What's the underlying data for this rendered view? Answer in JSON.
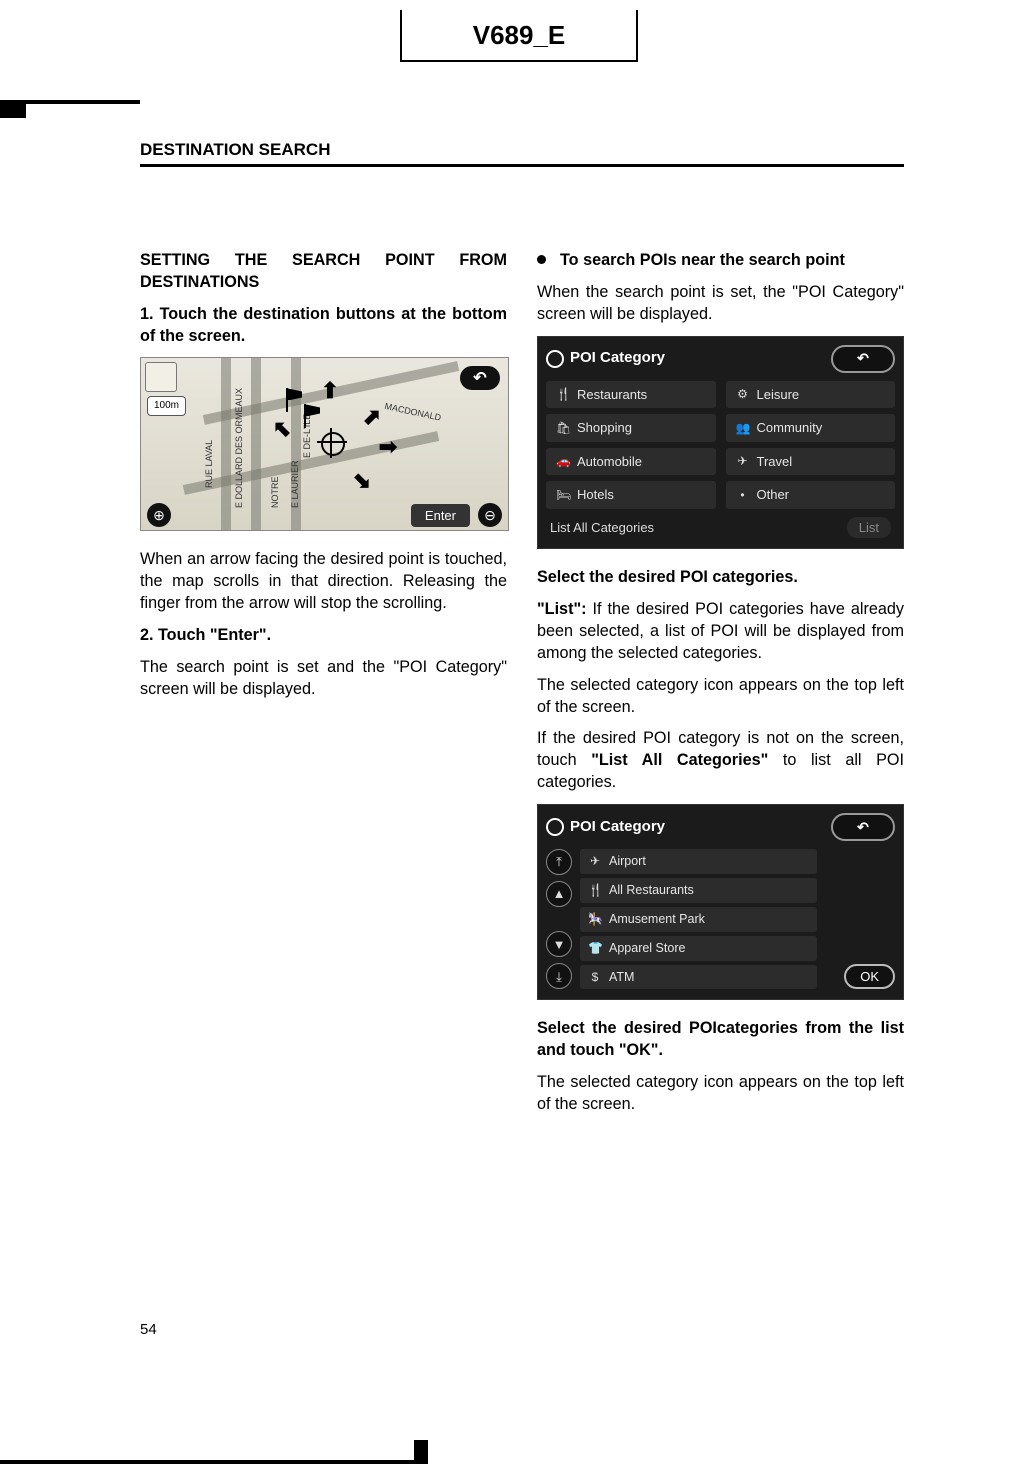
{
  "header": {
    "title": "V689_E"
  },
  "section": {
    "title": "DESTINATION SEARCH"
  },
  "left": {
    "heading": "SETTING THE SEARCH POINT FROM DESTINATIONS",
    "step1": "1.  Touch the destination buttons at the bottom of the screen.",
    "map": {
      "scale": "100m",
      "enter": "Enter",
      "back_symbol": "↶",
      "plus": "⊕",
      "minus": "⊖",
      "streets": {
        "rue_laval": "RUE LAVAL",
        "dollard": "E DOLLARD DES ORMEAUX",
        "notre": "NOTRE",
        "laurier": "E LAURIER",
        "delile": "E DE-L'ILE",
        "macdonald": "MACDONALD"
      }
    },
    "p1": "When an arrow facing the desired point is touched, the map scrolls in that direction. Releasing the finger from the arrow will stop the scrolling.",
    "step2": "2.  Touch \"Enter\".",
    "p2": "The search point is set and the \"POI Category\" screen will be displayed."
  },
  "right": {
    "bullet": "To search POIs near the search point",
    "p1": "When the search point is set, the \"POI Category\" screen will be displayed.",
    "shot2": {
      "title": "POI Category",
      "back_symbol": "↶",
      "items": [
        {
          "icon": "🍴",
          "label": "Restaurants"
        },
        {
          "icon": "⚙",
          "label": "Leisure"
        },
        {
          "icon": "🛍",
          "label": "Shopping"
        },
        {
          "icon": "👥",
          "label": "Community"
        },
        {
          "icon": "🚗",
          "label": "Automobile"
        },
        {
          "icon": "✈",
          "label": "Travel"
        },
        {
          "icon": "🛏",
          "label": "Hotels"
        },
        {
          "icon": "•",
          "label": "Other"
        }
      ],
      "list_all": "List All Categories",
      "list_btn": "List"
    },
    "p2": "Select the desired POI categories.",
    "p3a": "\"List\":",
    "p3b": " If the desired POI categories have already been selected, a list of POI will be displayed from among the selected categories.",
    "p4": "The selected category icon appears on the top left of the screen.",
    "p5a": "If the desired POI category is not on the screen, touch ",
    "p5b": "\"List All Categories\"",
    "p5c": " to list all POI categories.",
    "shot3": {
      "title": "POI Category",
      "back_symbol": "↶",
      "items": [
        {
          "icon": "✈",
          "label": "Airport"
        },
        {
          "icon": "🍴",
          "label": "All Restaurants"
        },
        {
          "icon": "🎠",
          "label": "Amusement Park"
        },
        {
          "icon": "👕",
          "label": "Apparel Store"
        },
        {
          "icon": "$",
          "label": "ATM"
        }
      ],
      "scroll": {
        "top": "⤒",
        "up": "▲",
        "down": "▼",
        "bottom": "⤓"
      },
      "ok": "OK"
    },
    "p6": "Select the desired POIcategories from the list and touch \"OK\".",
    "p7": "The selected category icon appears on the top left of the screen."
  },
  "page_number": "54"
}
